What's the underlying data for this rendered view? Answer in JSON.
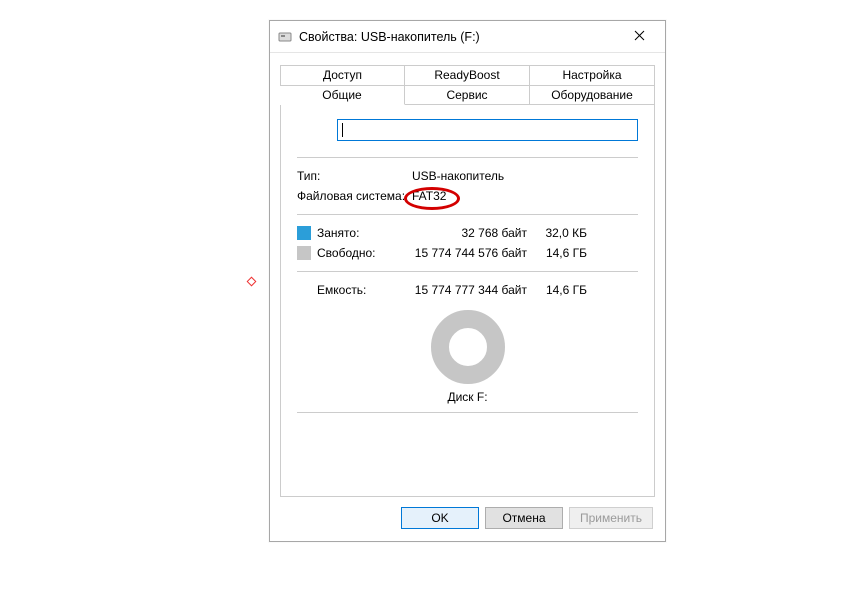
{
  "window": {
    "title": "Свойства: USB-накопитель (F:)"
  },
  "tabs": {
    "row1": [
      "Доступ",
      "ReadyBoost",
      "Настройка"
    ],
    "row2": [
      "Общие",
      "Сервис",
      "Оборудование"
    ],
    "active": "Общие"
  },
  "general": {
    "name_value": "",
    "type_label": "Тип:",
    "type_value": "USB-накопитель",
    "fs_label": "Файловая система:",
    "fs_value": "FAT32",
    "used_label": "Занято:",
    "used_bytes": "32 768 байт",
    "used_size": "32,0 КБ",
    "free_label": "Свободно:",
    "free_bytes": "15 774 744 576 байт",
    "free_size": "14,6 ГБ",
    "cap_label": "Емкость:",
    "cap_bytes": "15 774 777 344 байт",
    "cap_size": "14,6 ГБ",
    "disk_label": "Диск F:"
  },
  "buttons": {
    "ok": "OK",
    "cancel": "Отмена",
    "apply": "Применить"
  },
  "colors": {
    "used": "#2b9ed9",
    "free": "#c6c6c6",
    "accent": "#0078d7",
    "highlight": "#d30000"
  }
}
